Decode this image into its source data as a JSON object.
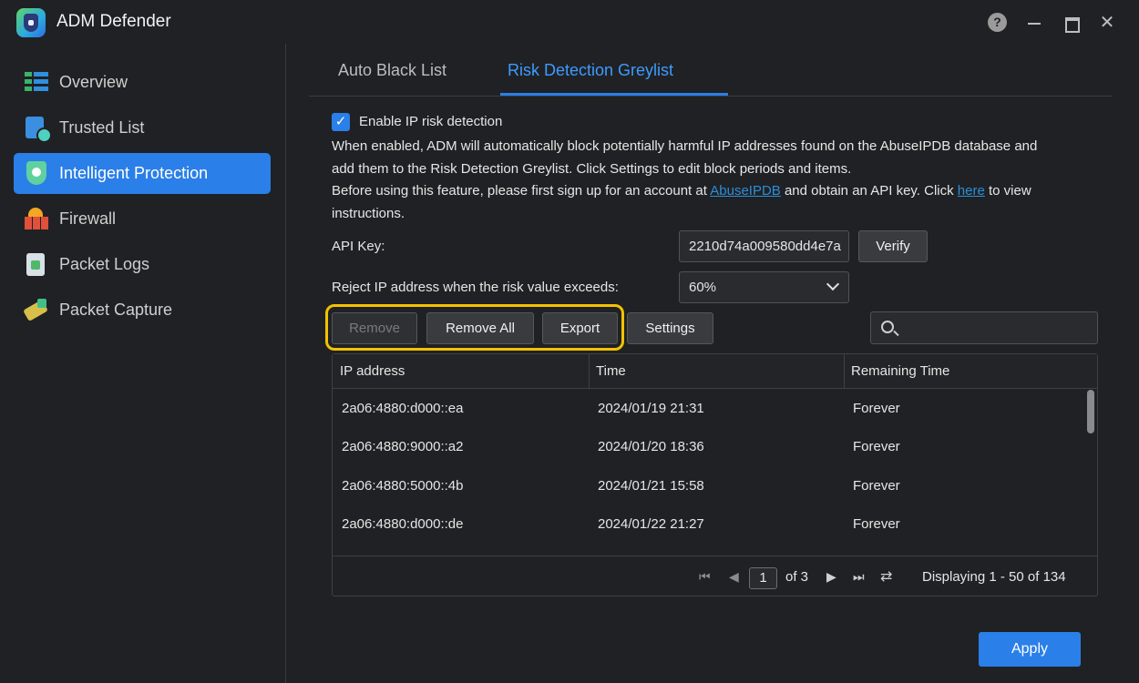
{
  "app": {
    "title": "ADM Defender"
  },
  "window_controls": {
    "help_glyph": "?",
    "close_glyph": "✕"
  },
  "sidebar": {
    "items": [
      {
        "label": "Overview",
        "icon": "overview-icon"
      },
      {
        "label": "Trusted List",
        "icon": "trusted-list-icon"
      },
      {
        "label": "Intelligent Protection",
        "icon": "intelligent-protection-icon",
        "active": true
      },
      {
        "label": "Firewall",
        "icon": "firewall-icon"
      },
      {
        "label": "Packet Logs",
        "icon": "packet-logs-icon"
      },
      {
        "label": "Packet Capture",
        "icon": "packet-capture-icon"
      }
    ]
  },
  "tabs": [
    {
      "label": "Auto Black List"
    },
    {
      "label": "Risk Detection Greylist",
      "active": true
    }
  ],
  "settings": {
    "enable_label": "Enable IP risk detection",
    "enabled": true,
    "check_glyph": "✓",
    "desc_line1": "When enabled, ADM will automatically block potentially harmful IP addresses found on the AbuseIPDB database and",
    "desc_line2": "add them to the Risk Detection Greylist. Click Settings to edit block periods and items.",
    "desc_line3_a": "Before using this feature, please first sign up for an account at ",
    "desc_line3_link": "AbuseIPDB",
    "desc_line3_b": " and obtain an API key. Click ",
    "desc_line3_link2": "here",
    "desc_line3_c": " to view",
    "desc_line4": "instructions.",
    "api_key_label": "API Key:",
    "api_key_value": "2210d74a009580dd4e7a",
    "verify_label": "Verify",
    "reject_label": "Reject IP address when the risk value exceeds:",
    "reject_value": "60%"
  },
  "toolbar": {
    "remove_label": "Remove",
    "remove_all_label": "Remove All",
    "export_label": "Export",
    "settings_label": "Settings",
    "search_placeholder": ""
  },
  "table": {
    "columns": [
      "IP address",
      "Time",
      "Remaining Time"
    ],
    "rows": [
      {
        "ip": "2a06:4880:d000::ea",
        "time": "2024/01/19 21:31",
        "remaining": "Forever"
      },
      {
        "ip": "2a06:4880:9000::a2",
        "time": "2024/01/20 18:36",
        "remaining": "Forever"
      },
      {
        "ip": "2a06:4880:5000::4b",
        "time": "2024/01/21 15:58",
        "remaining": "Forever"
      },
      {
        "ip": "2a06:4880:d000::de",
        "time": "2024/01/22 21:27",
        "remaining": "Forever"
      }
    ]
  },
  "pagination": {
    "current_page": "1",
    "of_text": "of 3",
    "display_text": "Displaying 1 - 50 of 134",
    "first_glyph": "⏮",
    "prev_glyph": "◀",
    "next_glyph": "▶",
    "last_glyph": "⏭",
    "refresh_glyph": "⇄"
  },
  "footer": {
    "apply_label": "Apply"
  },
  "colors": {
    "accent": "#2b7fe8",
    "highlight": "#f2c200",
    "link": "#2b8fd8"
  }
}
